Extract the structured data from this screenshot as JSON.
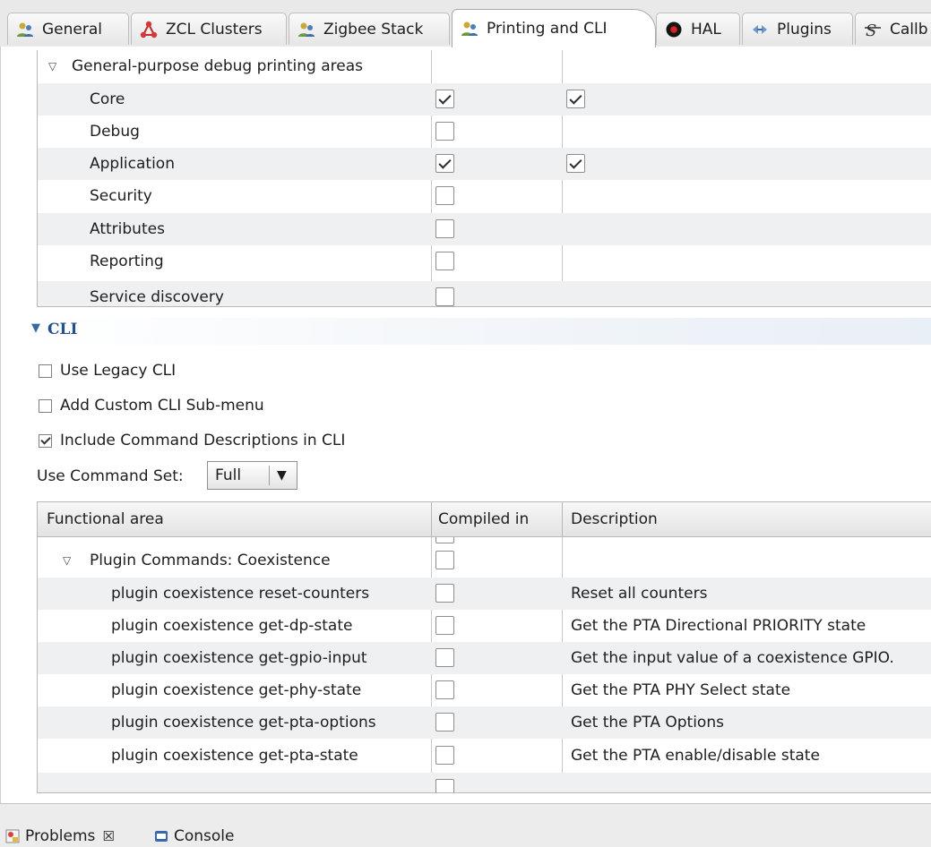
{
  "tabs": [
    {
      "label": "General",
      "icon": "people-icon",
      "active": false
    },
    {
      "label": "ZCL Clusters",
      "icon": "cluster-icon",
      "active": false
    },
    {
      "label": "Zigbee Stack",
      "icon": "people-icon",
      "active": false
    },
    {
      "label": "Printing and CLI",
      "icon": "people-icon",
      "active": true
    },
    {
      "label": "HAL",
      "icon": "hal-icon",
      "active": false
    },
    {
      "label": "Plugins",
      "icon": "plugin-icon",
      "active": false
    },
    {
      "label": "Callb",
      "icon": "callback-icon",
      "active": false
    }
  ],
  "debug_printing": {
    "group_label": "General-purpose debug printing areas",
    "rows": [
      {
        "label": "Core",
        "col1": true,
        "col2": true
      },
      {
        "label": "Debug",
        "col1": false,
        "col2": null
      },
      {
        "label": "Application",
        "col1": true,
        "col2": true
      },
      {
        "label": "Security",
        "col1": false,
        "col2": null
      },
      {
        "label": "Attributes",
        "col1": false,
        "col2": null
      },
      {
        "label": "Reporting",
        "col1": false,
        "col2": null
      },
      {
        "label": "Service discovery",
        "col1": false,
        "col2": null
      }
    ]
  },
  "cli": {
    "section_title": "CLI",
    "options": [
      {
        "label": "Use Legacy CLI",
        "checked": false
      },
      {
        "label": "Add Custom CLI Sub-menu",
        "checked": false
      },
      {
        "label": "Include Command Descriptions in CLI",
        "checked": true
      }
    ],
    "command_set_label": "Use Command Set:",
    "command_set_value": "Full",
    "table": {
      "headers": [
        "Functional area",
        "Compiled in",
        "Description"
      ],
      "group_label": "Plugin Commands: Coexistence",
      "rows": [
        {
          "area": "plugin coexistence reset-counters",
          "compiled": false,
          "description": "Reset all counters"
        },
        {
          "area": "plugin coexistence get-dp-state",
          "compiled": false,
          "description": "Get the PTA Directional PRIORITY state"
        },
        {
          "area": "plugin coexistence get-gpio-input",
          "compiled": false,
          "description": "Get the input value of a coexistence GPIO."
        },
        {
          "area": "plugin coexistence get-phy-state",
          "compiled": false,
          "description": "Get the PTA PHY Select state"
        },
        {
          "area": "plugin coexistence get-pta-options",
          "compiled": false,
          "description": "Get the PTA Options"
        },
        {
          "area": "plugin coexistence get-pta-state",
          "compiled": false,
          "description": "Get the PTA enable/disable state"
        }
      ]
    }
  },
  "bottom_tabs": [
    {
      "label": "Problems",
      "icon": "problems-icon",
      "close": "☒"
    },
    {
      "label": "Console",
      "icon": "console-icon"
    }
  ]
}
